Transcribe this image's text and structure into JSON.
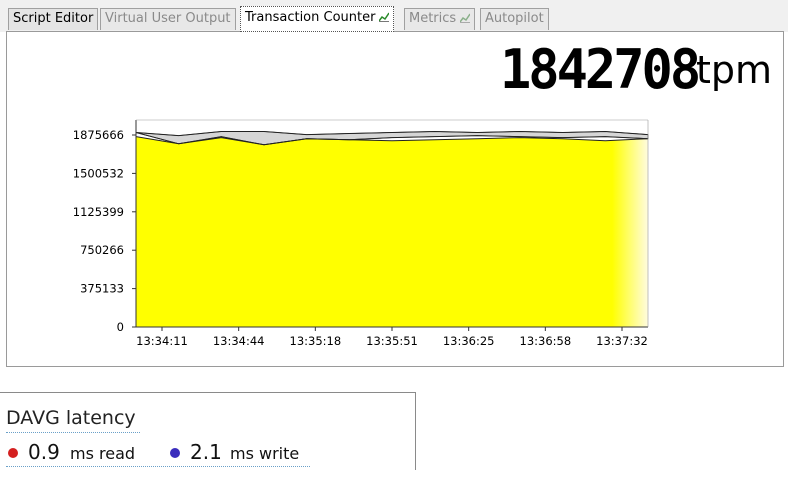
{
  "tabs": [
    {
      "label": "Script Editor",
      "state": "normal"
    },
    {
      "label": "Virtual User Output",
      "state": "disabled"
    },
    {
      "label": "Transaction Counter",
      "state": "active",
      "icon": "chart-icon"
    },
    {
      "label": "Metrics",
      "state": "disabled",
      "icon": "chart-icon"
    },
    {
      "label": "Autopilot",
      "state": "disabled"
    }
  ],
  "counter": {
    "value": "1842708",
    "unit": "tpm"
  },
  "colors": {
    "fill": "#ffff00",
    "band": "#d6d6d6",
    "read_dot": "#d42020",
    "write_dot": "#3a2dbd"
  },
  "chart_data": {
    "type": "area",
    "y_ticks": [
      "0",
      "375133",
      "750266",
      "1125399",
      "1500532",
      "1875666"
    ],
    "ylim": [
      0,
      1875666
    ],
    "xlim": [
      0,
      12
    ],
    "x_ticks": [
      "13:34:11",
      "13:34:44",
      "13:35:18",
      "13:35:51",
      "13:36:25",
      "13:36:58",
      "13:37:32"
    ],
    "series": [
      {
        "values": [
          1900000,
          1790000,
          1860000,
          1780000,
          1840000,
          1830000,
          1850000,
          1860000,
          1870000,
          1860000,
          1850000,
          1860000,
          1840000
        ]
      },
      {
        "values": [
          1860000,
          1790000,
          1850000,
          1780000,
          1840000,
          1830000,
          1820000,
          1830000,
          1840000,
          1850000,
          1840000,
          1820000,
          1840000
        ]
      },
      {
        "values": [
          1900000,
          1870000,
          1910000,
          1910000,
          1880000,
          1890000,
          1900000,
          1910000,
          1900000,
          1910000,
          1900000,
          1910000,
          1880000
        ]
      }
    ]
  },
  "latency": {
    "title": "DAVG latency",
    "read_value": "0.9",
    "read_label": "ms read",
    "write_value": "2.1",
    "write_label": "ms write"
  }
}
